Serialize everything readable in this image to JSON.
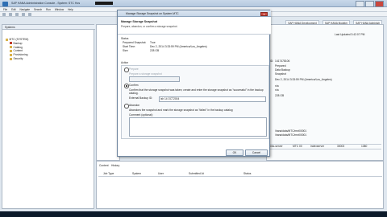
{
  "window": {
    "title": "SAP HANA Administration Console - System: STC Hos",
    "controls": [
      "minimize-icon",
      "maximize-icon",
      "close-icon"
    ]
  },
  "menu": [
    "File",
    "Edit",
    "Navigate",
    "Search",
    "Run",
    "Window",
    "Help"
  ],
  "perspectives": [
    "SAP HANA Development",
    "SAP HANA Modeler",
    "SAP HANA Administr"
  ],
  "left_pane": {
    "tab": "Systems",
    "tree": [
      "MTC (SYSTEM)",
      "Backup",
      "Catalog",
      "Content",
      "Provisioning",
      "Security"
    ]
  },
  "right_pane": {
    "last_updated": "Last Updated 3:42:07 PM",
    "fields": [
      {
        "label": "ID:",
        "value": "1417478106"
      },
      {
        "label": "",
        "value": "Prepared"
      },
      {
        "label": "",
        "value": "Data Backup"
      },
      {
        "label": "",
        "value": "Snapshot"
      },
      {
        "label": "",
        "value": "Dec 2, 2014 3:33:59 PM (America/Los_Angeles)"
      },
      {
        "label": "",
        "value": "n/a"
      },
      {
        "label": "",
        "value": "n/a"
      },
      {
        "label": "",
        "value": "228 GB"
      }
    ],
    "paths": [
      "/hana/data/MTC/mnt00001",
      "/hana/data/MTC/mnt00001"
    ],
    "table_row": [
      "mtc-server",
      "MTC 00",
      "indexserver",
      "30003",
      "1380"
    ]
  },
  "bottom_pane": {
    "tabs": [
      "Content",
      "History"
    ],
    "columns": [
      "Job Type",
      "System",
      "User",
      "Submitted At",
      "Status"
    ]
  },
  "dialog": {
    "title": "Manage Storage Snapshot on System MTC",
    "header_title": "Manage Storage Snapshot",
    "header_subtitle": "Prepare, abandon, or confirm a storage snapshot.",
    "details_label": "Status",
    "prepared_snapshot_label": "Prepared Snapshot:",
    "prepared_snapshot_value": "True",
    "start_time_label": "Start Time:",
    "start_time_value": "Dec 2, 2014 3:33:59 PM (America/Los_Angeles)",
    "size_label": "Size:",
    "size_value": "228 GB",
    "action_label": "Action",
    "prepare_label": "Prepare",
    "prepare_desc": "Prepare a storage snapshot",
    "confirm_label": "Confirm",
    "confirm_desc": "Confirm that the storage snapshot was taken; create and enter the storage snapshot as \"successful\" in the backup catalog.",
    "external_id_label": "External Backup ID:",
    "external_id_value": "ish 14 OCT2004",
    "abandon_label": "Abandon",
    "abandon_desc": "Abandons the snapshot and mark the storage snapshot as \"failed\" in the backup catalog",
    "comment_label": "Comment (optional):",
    "ok_label": "OK",
    "cancel_label": "Cancel"
  }
}
